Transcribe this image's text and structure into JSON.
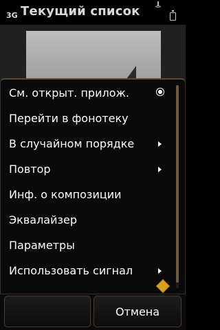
{
  "status": {
    "network": "3G",
    "title": "Текущий список"
  },
  "menu": {
    "items": [
      {
        "label": "См. открыт. прилож.",
        "indicator": "radio-selected"
      },
      {
        "label": "Перейти в фонотеку",
        "indicator": "none"
      },
      {
        "label": "В случайном порядке",
        "indicator": "submenu-arrow"
      },
      {
        "label": "Повтор",
        "indicator": "submenu-arrow"
      },
      {
        "label": "Инф. о композиции",
        "indicator": "none"
      },
      {
        "label": "Эквалайзер",
        "indicator": "none"
      },
      {
        "label": "Параметры",
        "indicator": "none"
      },
      {
        "label": "Использовать сигнал",
        "indicator": "submenu-arrow"
      }
    ]
  },
  "softkeys": {
    "left": "",
    "right": "Отмена"
  },
  "colors": {
    "accent_border": "#5a4a34",
    "background": "#000000",
    "text": "#ffffff"
  }
}
